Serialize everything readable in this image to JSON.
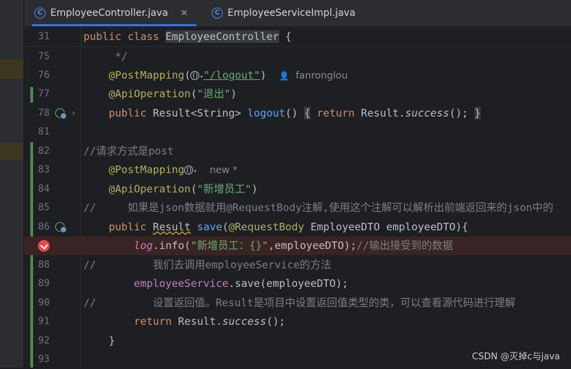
{
  "tabs": [
    {
      "label": "EmployeeController.java",
      "icon": "class-icon",
      "glyph": "C",
      "close": "✕"
    },
    {
      "label": "EmployeeServiceImpl.java",
      "icon": "class-icon",
      "glyph": "C"
    }
  ],
  "sticky": {
    "ln": "31",
    "kw1": "public",
    "kw2": "class",
    "cls": "EmployeeController",
    "tail": " {"
  },
  "lines": {
    "l75": {
      "ln": "75",
      "text": "     */"
    },
    "l76": {
      "ln": "76",
      "ann": "@PostMapping",
      "paren": "(",
      "str": "\"/logout\"",
      "close": ")",
      "author": "fanronglou"
    },
    "l77": {
      "ln": "77",
      "ann": "@ApiOperation",
      "open": "(",
      "str": "\"退出\"",
      "close": ")"
    },
    "l78": {
      "ln": "78",
      "kw": "public",
      "type": " Result<String> ",
      "fn": "logout",
      "args": "()",
      "ob": "{",
      "ret": "return",
      "call": " Result.",
      "succ": "success",
      "tail": "();",
      "cb": "}"
    },
    "l81": {
      "ln": "81"
    },
    "l82": {
      "ln": "82",
      "text": "//请求方式是post"
    },
    "l83": {
      "ln": "83",
      "ann": "@PostMapping",
      "hint": "new *"
    },
    "l84": {
      "ln": "84",
      "ann": "@ApiOperation",
      "open": "(",
      "str": "\"新增员工\"",
      "close": ")"
    },
    "l85": {
      "ln": "85",
      "text": "//     如果是json数据就用@RequestBody注解,使用这个注解可以解析出前端返回来的json中的"
    },
    "l86": {
      "ln": "86",
      "kw": "public",
      "type": "Result",
      "fn": "save",
      "ann": "@RequestBody",
      "rest": " EmployeeDTO employeeDTO){"
    },
    "l87": {
      "ln": "87",
      "fld": "log",
      "m": ".info(",
      "str": "\"新增员工：{}\"",
      "rest": ",employeeDTO);",
      "cmt": "//输出接受到的数据"
    },
    "l88": {
      "ln": "88",
      "text": "//         我们去调用employeeService的方法"
    },
    "l89": {
      "ln": "89",
      "fld": "employeeService",
      "rest": ".save(employeeDTO);"
    },
    "l90": {
      "ln": "90",
      "text": "//         设置返回值。Result是项目中设置返回值类型的类，可以查看源代码进行理解"
    },
    "l91": {
      "ln": "91",
      "kw": "return",
      "call": " Result.",
      "succ": "success",
      "tail": "();"
    },
    "l92": {
      "ln": "92",
      "text": "    }"
    },
    "l93": {
      "ln": "93"
    }
  },
  "watermark": "CSDN @灭掉c与java",
  "colors": {
    "keyword": "#cf8e6d",
    "annotation": "#b3ae60",
    "string": "#6aab73",
    "function": "#56a8f5",
    "comment": "#7a7e85",
    "field": "#c77dbb",
    "breakpoint": "#e5494a",
    "accent": "#3574f0"
  }
}
